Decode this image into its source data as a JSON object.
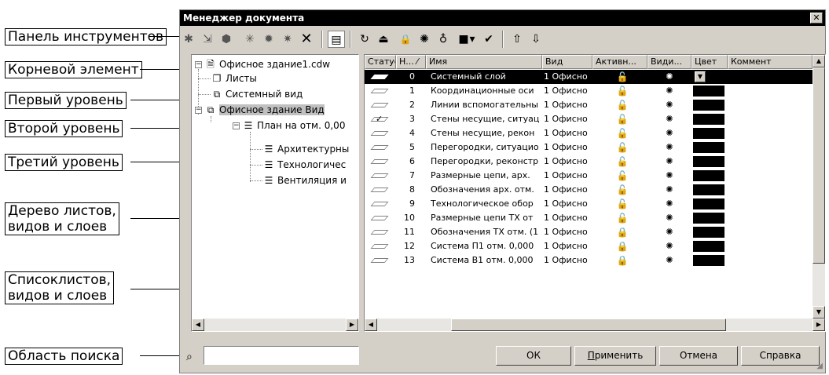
{
  "callouts": {
    "toolbar": "Панель инструментов",
    "root": "Корневой элемент",
    "level1": "Первый уровень",
    "level2": "Второй уровень",
    "level3": "Третий уровень",
    "tree_line1": "Дерево листов,",
    "tree_line2": "видов и слоев",
    "list_line1": "Списоклистов,",
    "list_line2": "видов и слоев",
    "search": "Область поиска"
  },
  "window": {
    "title": "Менеджер документа",
    "close": "✕"
  },
  "toolbar": {
    "icons": [
      "new-sheet-icon",
      "new-view-icon",
      "new-layer-icon",
      "sheet-star-icon",
      "view-star-icon",
      "layer-star-icon",
      "delete-icon",
      "details-view-icon",
      "rename-icon",
      "activate-icon",
      "lock-icon",
      "light-on-icon",
      "light-off-icon",
      "color-icon",
      "color-dropdown-icon",
      "properties-icon",
      "export-icon",
      "import-icon"
    ],
    "glyphs": [
      "✱",
      "⇲",
      "⬢",
      "✳",
      "✹",
      "✷",
      "✕",
      "▤",
      "↻",
      "⏏",
      "🔒",
      "✺",
      "♁",
      "■",
      "▾",
      "✔",
      "⇧",
      "⇩"
    ]
  },
  "tree": {
    "root": "Офисное здание1.cdw",
    "sheets": "Листы",
    "system_view": "Системный вид",
    "office_view": "Офисное здание Вид",
    "plan": "План на отм. 0,00",
    "arch": "Архитектурны",
    "tech": "Технологичес",
    "vent": "Вентиляция и"
  },
  "list": {
    "columns": [
      "Статус",
      "Н... ⁄",
      "Имя",
      "Вид",
      "Активн...",
      "Види...",
      "Цвет",
      "Коммент"
    ],
    "rows": [
      {
        "num": "0",
        "name": "Системный слой",
        "view": "1 Офисно",
        "active": "unlocked",
        "visible": true,
        "selected": true
      },
      {
        "num": "1",
        "name": "Координационные оси",
        "view": "1 Офисно",
        "active": "unlocked",
        "visible": true
      },
      {
        "num": "2",
        "name": "Линии вспомогательны",
        "view": "1 Офисно",
        "active": "unlocked",
        "visible": true
      },
      {
        "num": "3",
        "name": "Стены несущие, ситуац",
        "view": "1 Офисно",
        "active": "unlocked",
        "visible": true,
        "checked": true
      },
      {
        "num": "4",
        "name": "Стены несущие, рекон",
        "view": "1 Офисно",
        "active": "unlocked",
        "visible": true
      },
      {
        "num": "5",
        "name": "Перегородки, ситуацио",
        "view": "1 Офисно",
        "active": "unlocked",
        "visible": true
      },
      {
        "num": "6",
        "name": "Перегородки, реконстр",
        "view": "1 Офисно",
        "active": "unlocked",
        "visible": true
      },
      {
        "num": "7",
        "name": "Размерные цепи, арх.",
        "view": "1 Офисно",
        "active": "unlocked",
        "visible": true
      },
      {
        "num": "8",
        "name": "Обозначения арх. отм.",
        "view": "1 Офисно",
        "active": "unlocked",
        "visible": true
      },
      {
        "num": "9",
        "name": "Технологическое обор",
        "view": "1 Офисно",
        "active": "unlocked",
        "visible": true
      },
      {
        "num": "10",
        "name": "Размерные цепи ТХ от",
        "view": "1 Офисно",
        "active": "unlocked",
        "visible": true
      },
      {
        "num": "11",
        "name": "Обозначения ТХ отм. (1",
        "view": "1 Офисно",
        "active": "locked",
        "visible": true
      },
      {
        "num": "12",
        "name": "Система П1 отм. 0,000",
        "view": "1 Офисно",
        "active": "locked",
        "visible": true
      },
      {
        "num": "13",
        "name": "Система В1 отм. 0,000",
        "view": "1 Офисно",
        "active": "locked",
        "visible": true
      }
    ]
  },
  "buttons": {
    "ok": "ОК",
    "apply_u": "П",
    "apply_rest": "рименить",
    "cancel": "Отмена",
    "help": "Справка"
  },
  "search": {
    "value": ""
  },
  "colors": {
    "selection": "#000000",
    "window_bg": "#d4d0c8",
    "swatch": "#000000"
  }
}
